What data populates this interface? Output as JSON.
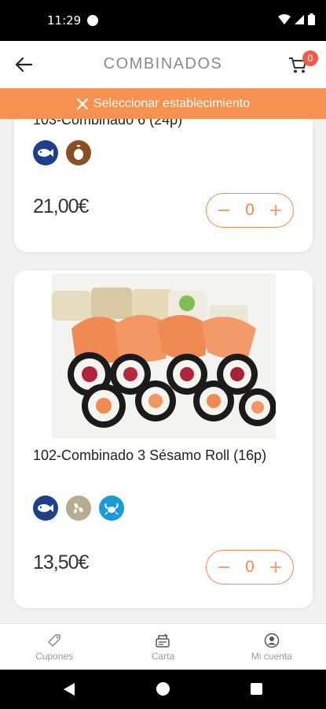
{
  "status_bar": {
    "time": "11:29"
  },
  "header": {
    "title": "COMBINADOS",
    "cart_count": "0"
  },
  "banner": {
    "label": "Seleccionar establecimiento"
  },
  "products": [
    {
      "name": "103-Combinado 6 (24p)",
      "price": "21,00€",
      "quantity": "0",
      "allergens": [
        "fish-icon",
        "egg-icon"
      ]
    },
    {
      "name": "102-Combinado 3 Sésamo Roll (16p)",
      "price": "13,50€",
      "quantity": "0",
      "allergens": [
        "fish-icon",
        "sesame-icon",
        "crustacean-icon"
      ]
    }
  ],
  "bottom_nav": {
    "coupons": "Cupones",
    "menu": "Carta",
    "account": "Mi cuenta"
  },
  "colors": {
    "accent": "#f5924f",
    "badge": "#ef5a4a",
    "fish": "#1f3f8a",
    "egg": "#8a4f22",
    "sesame": "#b8ab8f",
    "crustacean": "#1a9ad6"
  }
}
